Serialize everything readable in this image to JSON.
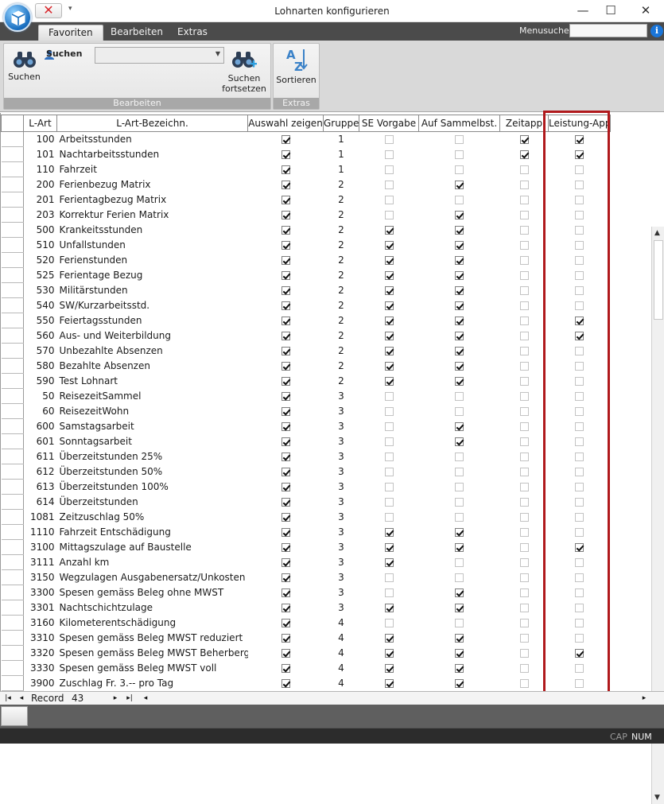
{
  "window": {
    "title": "Lohnarten konfigurieren",
    "close_glyph": "✕",
    "qa_menu_glyph": "▾",
    "min_glyph": "—",
    "max_glyph": "☐",
    "win_close_glyph": "✕"
  },
  "tabs": [
    {
      "label": "Favoriten",
      "active": true
    },
    {
      "label": "Bearbeiten"
    },
    {
      "label": "Extras"
    }
  ],
  "menusuche": {
    "label": "Menusuche",
    "value": "",
    "info_glyph": "i"
  },
  "ribbon": {
    "group_bearbeiten": {
      "label": "Bearbeiten",
      "search_button": "Suchen",
      "search_small_label": "Suchen",
      "search_combo_value": "",
      "search_next_line1": "Suchen",
      "search_next_line2": "fortsetzen"
    },
    "group_extras": {
      "label": "Extras",
      "sort_button": "Sortieren"
    }
  },
  "grid": {
    "columns": [
      "L-Art",
      "L-Art-Bezeichn.",
      "Auswahl zeigen",
      "Gruppe",
      "SE Vorgabe",
      "Auf Sammelbst.",
      "Zeitapp",
      "Leistung-App"
    ],
    "rows": [
      {
        "lart": "100",
        "name": "Arbeitsstunden",
        "auswahl": true,
        "gruppe": "1",
        "se": false,
        "sammel": false,
        "zeitapp": true,
        "leistung": true
      },
      {
        "lart": "101",
        "name": "Nachtarbeitsstunden",
        "auswahl": true,
        "gruppe": "1",
        "se": false,
        "sammel": false,
        "zeitapp": true,
        "leistung": true
      },
      {
        "lart": "110",
        "name": "Fahrzeit",
        "auswahl": true,
        "gruppe": "1",
        "se": false,
        "sammel": false,
        "zeitapp": false,
        "leistung": false
      },
      {
        "lart": "200",
        "name": "Ferienbezug Matrix",
        "auswahl": true,
        "gruppe": "2",
        "se": false,
        "sammel": true,
        "zeitapp": false,
        "leistung": false
      },
      {
        "lart": "201",
        "name": "Ferientagbezug Matrix",
        "auswahl": true,
        "gruppe": "2",
        "se": false,
        "sammel": false,
        "zeitapp": false,
        "leistung": false
      },
      {
        "lart": "203",
        "name": "Korrektur Ferien Matrix",
        "auswahl": true,
        "gruppe": "2",
        "se": false,
        "sammel": true,
        "zeitapp": false,
        "leistung": false
      },
      {
        "lart": "500",
        "name": "Krankeitsstunden",
        "auswahl": true,
        "gruppe": "2",
        "se": true,
        "sammel": true,
        "zeitapp": false,
        "leistung": false
      },
      {
        "lart": "510",
        "name": "Unfallstunden",
        "auswahl": true,
        "gruppe": "2",
        "se": true,
        "sammel": true,
        "zeitapp": false,
        "leistung": false
      },
      {
        "lart": "520",
        "name": "Ferienstunden",
        "auswahl": true,
        "gruppe": "2",
        "se": true,
        "sammel": true,
        "zeitapp": false,
        "leistung": false
      },
      {
        "lart": "525",
        "name": "Ferientage Bezug",
        "auswahl": true,
        "gruppe": "2",
        "se": true,
        "sammel": true,
        "zeitapp": false,
        "leistung": false
      },
      {
        "lart": "530",
        "name": "Militärstunden",
        "auswahl": true,
        "gruppe": "2",
        "se": true,
        "sammel": true,
        "zeitapp": false,
        "leistung": false
      },
      {
        "lart": "540",
        "name": "SW/Kurzarbeitsstd.",
        "auswahl": true,
        "gruppe": "2",
        "se": true,
        "sammel": true,
        "zeitapp": false,
        "leistung": false
      },
      {
        "lart": "550",
        "name": "Feiertagsstunden",
        "auswahl": true,
        "gruppe": "2",
        "se": true,
        "sammel": true,
        "zeitapp": false,
        "leistung": true
      },
      {
        "lart": "560",
        "name": "Aus- und Weiterbildung",
        "auswahl": true,
        "gruppe": "2",
        "se": true,
        "sammel": true,
        "zeitapp": false,
        "leistung": true
      },
      {
        "lart": "570",
        "name": "Unbezahlte Absenzen",
        "auswahl": true,
        "gruppe": "2",
        "se": true,
        "sammel": true,
        "zeitapp": false,
        "leistung": false
      },
      {
        "lart": "580",
        "name": "Bezahlte Absenzen",
        "auswahl": true,
        "gruppe": "2",
        "se": true,
        "sammel": true,
        "zeitapp": false,
        "leistung": false
      },
      {
        "lart": "590",
        "name": "Test Lohnart",
        "auswahl": true,
        "gruppe": "2",
        "se": true,
        "sammel": true,
        "zeitapp": false,
        "leistung": false
      },
      {
        "lart": "50",
        "name": "ReisezeitSammel",
        "auswahl": true,
        "gruppe": "3",
        "se": false,
        "sammel": false,
        "zeitapp": false,
        "leistung": false
      },
      {
        "lart": "60",
        "name": "ReisezeitWohn",
        "auswahl": true,
        "gruppe": "3",
        "se": false,
        "sammel": false,
        "zeitapp": false,
        "leistung": false
      },
      {
        "lart": "600",
        "name": "Samstagsarbeit",
        "auswahl": true,
        "gruppe": "3",
        "se": false,
        "sammel": true,
        "zeitapp": false,
        "leistung": false
      },
      {
        "lart": "601",
        "name": "Sonntagsarbeit",
        "auswahl": true,
        "gruppe": "3",
        "se": false,
        "sammel": true,
        "zeitapp": false,
        "leistung": false
      },
      {
        "lart": "611",
        "name": "Überzeitstunden 25%",
        "auswahl": true,
        "gruppe": "3",
        "se": false,
        "sammel": false,
        "zeitapp": false,
        "leistung": false
      },
      {
        "lart": "612",
        "name": "Überzeitstunden 50%",
        "auswahl": true,
        "gruppe": "3",
        "se": false,
        "sammel": false,
        "zeitapp": false,
        "leistung": false
      },
      {
        "lart": "613",
        "name": "Überzeitstunden 100%",
        "auswahl": true,
        "gruppe": "3",
        "se": false,
        "sammel": false,
        "zeitapp": false,
        "leistung": false
      },
      {
        "lart": "614",
        "name": "Überzeitstunden",
        "auswahl": true,
        "gruppe": "3",
        "se": false,
        "sammel": false,
        "zeitapp": false,
        "leistung": false
      },
      {
        "lart": "1081",
        "name": "Zeitzuschlag 50%",
        "auswahl": true,
        "gruppe": "3",
        "se": false,
        "sammel": false,
        "zeitapp": false,
        "leistung": false
      },
      {
        "lart": "1110",
        "name": "Fahrzeit Entschädigung",
        "auswahl": true,
        "gruppe": "3",
        "se": true,
        "sammel": true,
        "zeitapp": false,
        "leistung": false
      },
      {
        "lart": "3100",
        "name": "Mittagszulage auf Baustelle",
        "auswahl": true,
        "gruppe": "3",
        "se": true,
        "sammel": true,
        "zeitapp": false,
        "leistung": true
      },
      {
        "lart": "3111",
        "name": "Anzahl km",
        "auswahl": true,
        "gruppe": "3",
        "se": true,
        "sammel": false,
        "zeitapp": false,
        "leistung": false
      },
      {
        "lart": "3150",
        "name": "Wegzulagen Ausgabenersatz/Unkosten",
        "auswahl": true,
        "gruppe": "3",
        "se": false,
        "sammel": false,
        "zeitapp": false,
        "leistung": false
      },
      {
        "lart": "3300",
        "name": "Spesen gemäss Beleg ohne MWST",
        "auswahl": true,
        "gruppe": "3",
        "se": false,
        "sammel": true,
        "zeitapp": false,
        "leistung": false
      },
      {
        "lart": "3301",
        "name": "Nachtschichtzulage",
        "auswahl": true,
        "gruppe": "3",
        "se": true,
        "sammel": true,
        "zeitapp": false,
        "leistung": false
      },
      {
        "lart": "3160",
        "name": "Kilometerentschädigung",
        "auswahl": true,
        "gruppe": "4",
        "se": false,
        "sammel": false,
        "zeitapp": false,
        "leistung": false
      },
      {
        "lart": "3310",
        "name": "Spesen gemäss Beleg MWST reduziert",
        "auswahl": true,
        "gruppe": "4",
        "se": true,
        "sammel": true,
        "zeitapp": false,
        "leistung": false
      },
      {
        "lart": "3320",
        "name": "Spesen gemäss Beleg MWST Beherberg.",
        "auswahl": true,
        "gruppe": "4",
        "se": true,
        "sammel": true,
        "zeitapp": false,
        "leistung": true
      },
      {
        "lart": "3330",
        "name": "Spesen gemäss Beleg MWST voll",
        "auswahl": true,
        "gruppe": "4",
        "se": true,
        "sammel": true,
        "zeitapp": false,
        "leistung": false
      },
      {
        "lart": "3900",
        "name": "Zuschlag Fr. 3.-- pro Tag",
        "auswahl": true,
        "gruppe": "4",
        "se": true,
        "sammel": true,
        "zeitapp": false,
        "leistung": false
      }
    ]
  },
  "navigator": {
    "record_label": "Record",
    "record_value": "43",
    "first_glyph": "|◂",
    "prev_glyph": "◂",
    "next_glyph": "▸",
    "last_glyph": "▸|",
    "nav_left_glyph": "◂",
    "nav_right_glyph": "▸",
    "scroll_up_glyph": "▲",
    "scroll_down_glyph": "▼"
  },
  "status": {
    "cap": "CAP",
    "num": "NUM"
  },
  "colors": {
    "highlight": "#b0191c",
    "tabbar": "#4b4b4b"
  }
}
